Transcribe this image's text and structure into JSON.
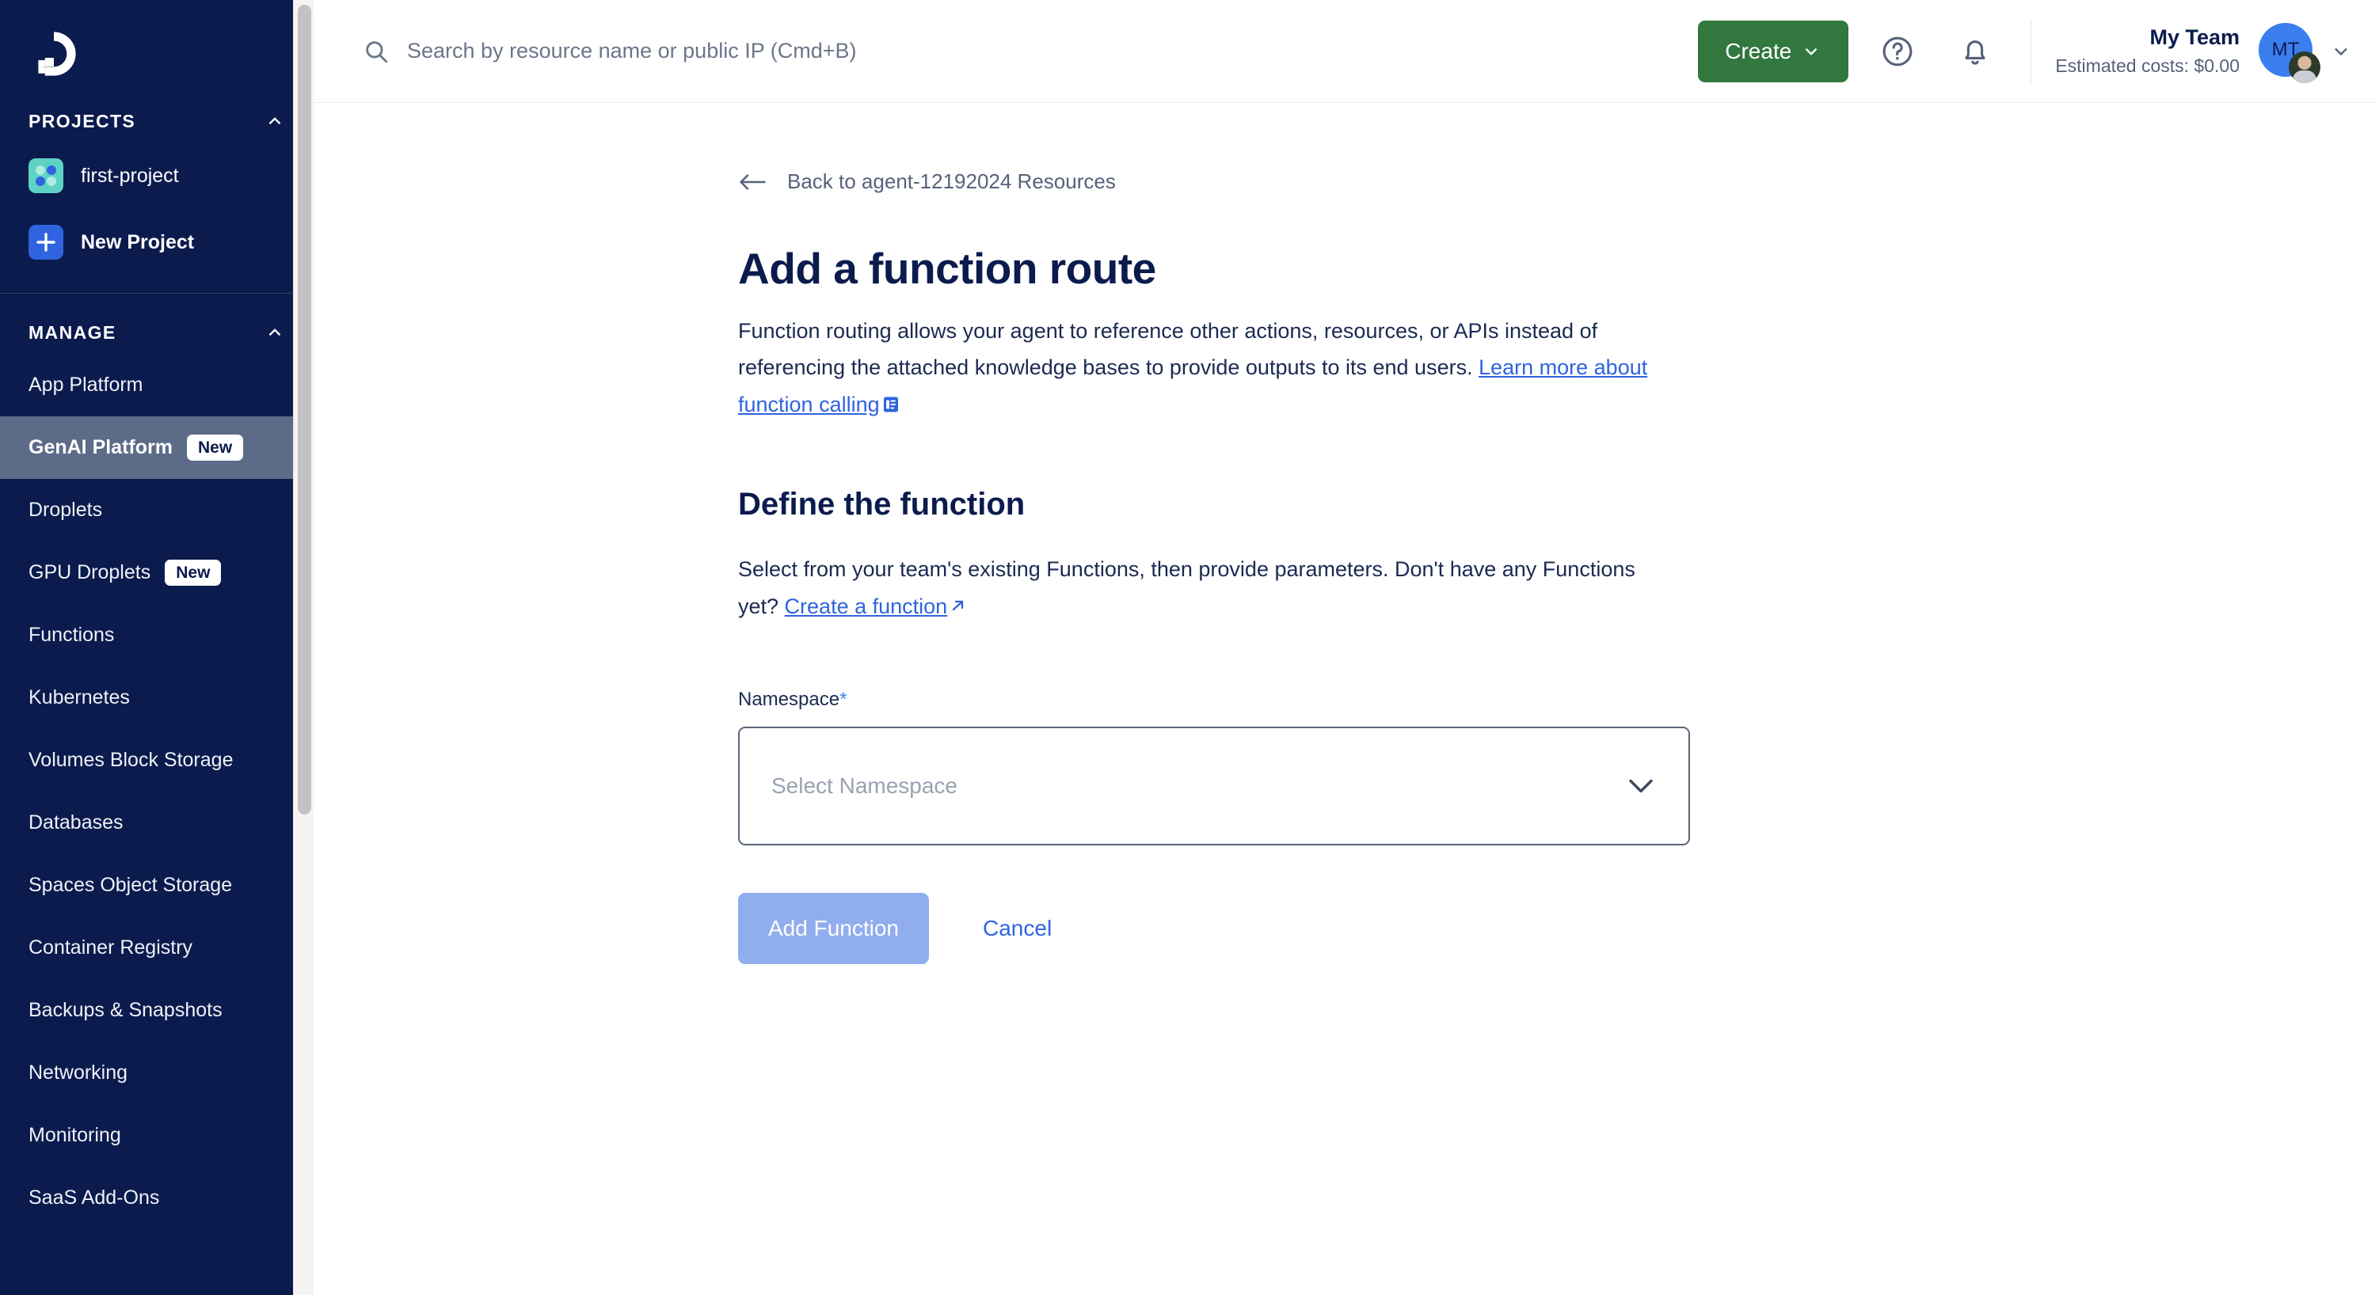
{
  "sidebar": {
    "logo_name": "digitalocean-logo",
    "projects": {
      "heading": "PROJECTS",
      "items": [
        {
          "label": "first-project",
          "icon": "project-dots-icon",
          "bold": false
        },
        {
          "label": "New Project",
          "icon": "plus-icon",
          "bold": true
        }
      ]
    },
    "manage": {
      "heading": "MANAGE",
      "items": [
        {
          "label": "App Platform",
          "badge": "",
          "active": false
        },
        {
          "label": "GenAI Platform",
          "badge": "New",
          "active": true
        },
        {
          "label": "Droplets",
          "badge": "",
          "active": false
        },
        {
          "label": "GPU Droplets",
          "badge": "New",
          "active": false
        },
        {
          "label": "Functions",
          "badge": "",
          "active": false
        },
        {
          "label": "Kubernetes",
          "badge": "",
          "active": false
        },
        {
          "label": "Volumes Block Storage",
          "badge": "",
          "active": false
        },
        {
          "label": "Databases",
          "badge": "",
          "active": false
        },
        {
          "label": "Spaces Object Storage",
          "badge": "",
          "active": false
        },
        {
          "label": "Container Registry",
          "badge": "",
          "active": false
        },
        {
          "label": "Backups & Snapshots",
          "badge": "",
          "active": false
        },
        {
          "label": "Networking",
          "badge": "",
          "active": false
        },
        {
          "label": "Monitoring",
          "badge": "",
          "active": false
        },
        {
          "label": "SaaS Add-Ons",
          "badge": "",
          "active": false
        }
      ]
    }
  },
  "topbar": {
    "search_placeholder": "Search by resource name or public IP (Cmd+B)",
    "search_value": "",
    "create_label": "Create",
    "help_icon": "help-circle-icon",
    "notifications_icon": "bell-icon",
    "team_name": "My Team",
    "estimated_costs": "Estimated costs: $0.00",
    "avatar_initials": "MT"
  },
  "content": {
    "back_link": "Back to agent-12192024 Resources",
    "page_title": "Add a function route",
    "lede_part1": "Function routing allows your agent to reference other actions, resources, or APIs instead of referencing the attached knowledge bases to provide outputs to its end users. ",
    "lede_link": "Learn more about function calling",
    "section_title": "Define the function",
    "section_body_part1": "Select from your team's existing Functions, then provide parameters. Don't have any Functions yet? ",
    "section_body_link": "Create a function",
    "namespace_label": "Namespace",
    "namespace_required_mark": "*",
    "namespace_placeholder": "Select Namespace",
    "add_function_label": "Add Function",
    "cancel_label": "Cancel"
  },
  "colors": {
    "sidebar_bg": "#0b1b4d",
    "sidebar_active": "#5c6b87",
    "create_green": "#31773e",
    "link_blue": "#2f63e0",
    "disabled_blue": "#90aeee",
    "accent_blue": "#3b7ef0"
  }
}
